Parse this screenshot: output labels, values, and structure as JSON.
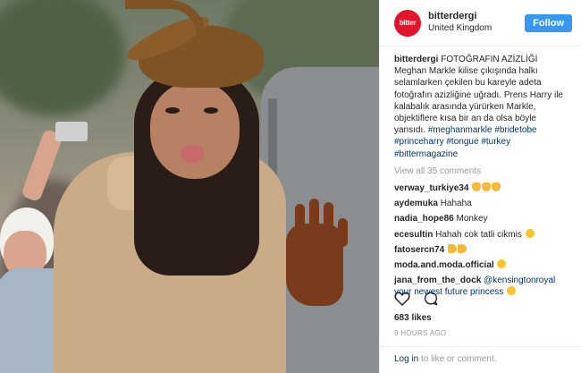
{
  "post": {
    "avatar_text": "bitter",
    "username": "bitterdergi",
    "location": "United Kingdom",
    "follow_label": "Follow",
    "caption_user": "bitterdergi",
    "caption_text": "FOTOĞRAFIN AZİZLİĞİ Meghan Markle kilise çıkışında halkı selamlarken çekilen bu kareyle adeta fotoğrafın azizliğine uğradı. Prens Harry ile kalabalık arasında yürürken Markle, objektiflere kısa bir an da olsa böyle yansıdı.",
    "hashtags": [
      "#meghanmarkle",
      "#bridetobe",
      "#princeharry",
      "#tongue",
      "#turkey",
      "#bittermagazine"
    ],
    "view_all": "View all 35 comments",
    "comments": [
      {
        "user": "verway_turkiye34",
        "text": "",
        "emoji": [
          "hand",
          "hand",
          "hand"
        ]
      },
      {
        "user": "aydemuka",
        "text": "Hahaha",
        "emoji": []
      },
      {
        "user": "nadia_hope86",
        "text": "Monkey",
        "emoji": []
      },
      {
        "user": "ecesultin",
        "text": "Hahah cok tatli cikmis",
        "emoji": [
          "face"
        ]
      },
      {
        "user": "fatosercn74",
        "text": "",
        "emoji": [
          "thumb",
          "thumb"
        ]
      },
      {
        "user": "moda.and.moda.official",
        "text": "",
        "emoji": [
          "face"
        ]
      },
      {
        "user": "jana_from_the_dock",
        "text": "@kensingtonroyal your newest future princess",
        "emoji": [
          "face"
        ]
      }
    ],
    "likes": "683 likes",
    "time": "9 HOURS AGO",
    "footer_login": "Log in",
    "footer_rest": "to like or comment."
  },
  "icons": [
    "heart-icon",
    "comment-icon"
  ],
  "colors": {
    "follow": "#3897f0",
    "brand": "#e3152b",
    "link": "#003569",
    "muted": "#999999"
  }
}
